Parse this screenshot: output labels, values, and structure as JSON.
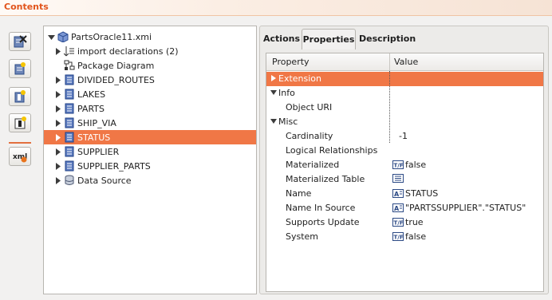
{
  "view": {
    "title": "Contents"
  },
  "toolbar": {
    "buttons": [
      {
        "icon": "clear-icon"
      },
      {
        "icon": "add-table-icon"
      },
      {
        "icon": "add-column-icon"
      },
      {
        "icon": "add-key-icon"
      },
      {
        "icon": "xml-icon"
      }
    ]
  },
  "tree": {
    "root": "PartsOracle11.xmi",
    "items": [
      {
        "label": "import declarations (2)",
        "icon": "import-icon",
        "expandable": true
      },
      {
        "label": "Package Diagram",
        "icon": "diagram-icon",
        "expandable": false
      },
      {
        "label": "DIVIDED_ROUTES",
        "icon": "table-icon",
        "expandable": true
      },
      {
        "label": "LAKES",
        "icon": "table-icon",
        "expandable": true
      },
      {
        "label": "PARTS",
        "icon": "table-icon",
        "expandable": true
      },
      {
        "label": "SHIP_VIA",
        "icon": "table-icon",
        "expandable": true
      },
      {
        "label": "STATUS",
        "icon": "table-icon",
        "expandable": true,
        "selected": true
      },
      {
        "label": "SUPPLIER",
        "icon": "table-icon",
        "expandable": true
      },
      {
        "label": "SUPPLIER_PARTS",
        "icon": "table-icon",
        "expandable": true
      },
      {
        "label": "Data Source",
        "icon": "datasource-icon",
        "expandable": true
      }
    ]
  },
  "tabs": [
    {
      "label": "Actions",
      "active": false
    },
    {
      "label": "Properties",
      "active": true
    },
    {
      "label": "Description",
      "active": false
    }
  ],
  "properties": {
    "header": {
      "property": "Property",
      "value": "Value"
    },
    "rows": [
      {
        "kind": "category",
        "name": "Extension",
        "expanded": false,
        "selected": true
      },
      {
        "kind": "category",
        "name": "Info",
        "expanded": true
      },
      {
        "kind": "prop",
        "name": "Object URI",
        "value": ""
      },
      {
        "kind": "category",
        "name": "Misc",
        "expanded": true
      },
      {
        "kind": "prop",
        "name": "Cardinality",
        "value": "-1"
      },
      {
        "kind": "prop",
        "name": "Logical Relationships",
        "value": ""
      },
      {
        "kind": "prop",
        "name": "Materialized",
        "value": "false",
        "icon": "boolean-icon"
      },
      {
        "kind": "prop",
        "name": "Materialized Table",
        "value": "",
        "icon": "list-icon"
      },
      {
        "kind": "prop",
        "name": "Name",
        "value": "STATUS",
        "icon": "text-icon"
      },
      {
        "kind": "prop",
        "name": "Name In Source",
        "value": "\"PARTSSUPPLIER\".\"STATUS\"",
        "icon": "text-icon"
      },
      {
        "kind": "prop",
        "name": "Supports Update",
        "value": "true",
        "icon": "boolean-icon"
      },
      {
        "kind": "prop",
        "name": "System",
        "value": "false",
        "icon": "boolean-icon"
      }
    ]
  },
  "colors": {
    "accent": "#f07746",
    "title": "#e1541c",
    "selection_text": "#ffffff"
  }
}
